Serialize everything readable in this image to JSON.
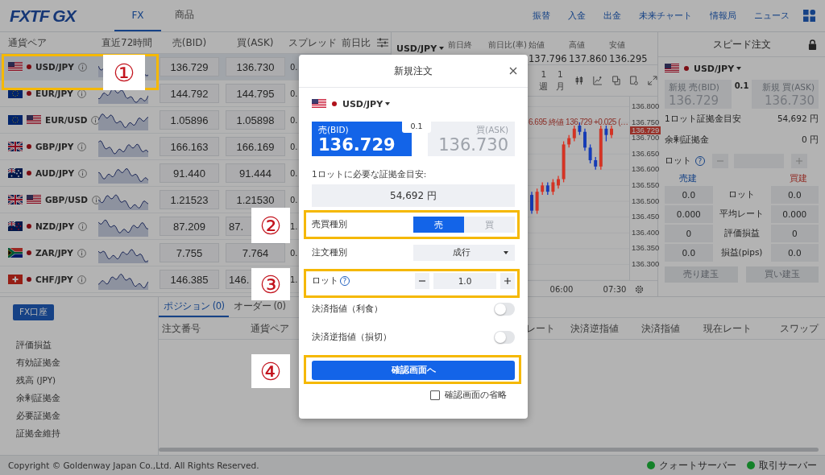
{
  "header": {
    "logo": "FXTF GX",
    "tabs": [
      {
        "label": "FX",
        "selected": true
      },
      {
        "label": "商品",
        "selected": false
      }
    ],
    "links": [
      "振替",
      "入金",
      "出金",
      "未来チャート",
      "情報局",
      "ニュース"
    ]
  },
  "rate_table": {
    "columns": [
      "通貨ペア",
      "直近72時間",
      "売(BID)",
      "買(ASK)",
      "スプレッド",
      "前日比"
    ],
    "rows": [
      {
        "pair": "USD/JPY",
        "bid": "136.729",
        "ask": "136.730",
        "spread": "0.",
        "selected": true,
        "ask_cut": false
      },
      {
        "pair": "EUR/JPY",
        "bid": "144.792",
        "ask": "144.795",
        "spread": "0.",
        "selected": false,
        "ask_cut": false
      },
      {
        "pair": "EUR/USD",
        "bid": "1.05896",
        "ask": "1.05898",
        "spread": "0.",
        "selected": false,
        "ask_cut": false
      },
      {
        "pair": "GBP/JPY",
        "bid": "166.163",
        "ask": "166.169",
        "spread": "0.",
        "selected": false,
        "ask_cut": false
      },
      {
        "pair": "AUD/JPY",
        "bid": "91.440",
        "ask": "91.444",
        "spread": "0.",
        "selected": false,
        "ask_cut": false
      },
      {
        "pair": "GBP/USD",
        "bid": "1.21523",
        "ask": "1.21530",
        "spread": "0.",
        "selected": false,
        "ask_cut": false
      },
      {
        "pair": "NZD/JPY",
        "bid": "87.209",
        "ask": "87.",
        "spread": "1.",
        "selected": false,
        "ask_cut": true
      },
      {
        "pair": "ZAR/JPY",
        "bid": "7.755",
        "ask": "7.764",
        "spread": "0.",
        "selected": false,
        "ask_cut": false
      },
      {
        "pair": "CHF/JPY",
        "bid": "146.385",
        "ask": "146.",
        "spread": "1.",
        "selected": false,
        "ask_cut": true
      }
    ]
  },
  "chart": {
    "pair": "USD/JPY",
    "stats": [
      {
        "label": "前日終"
      },
      {
        "label": "前日比(率)"
      },
      {
        "label": "始値",
        "value": "137.796"
      },
      {
        "label": "高値",
        "value": "137.860"
      },
      {
        "label": "安値",
        "value": "136.295"
      }
    ],
    "periods": [
      {
        "number": "1",
        "unit": "週"
      },
      {
        "number": "1",
        "unit": "月"
      }
    ],
    "legend": "6.695 終値 136.729 +0.025 (…",
    "last_price": "136.729",
    "chart_data": {
      "type": "candlestick",
      "categories": [
        null,
        null,
        null,
        null,
        null,
        null,
        "06:00",
        null,
        null,
        null,
        null,
        null,
        null,
        null,
        null,
        null,
        "07:30"
      ],
      "ylim": [
        136.249,
        136.831
      ],
      "ohlc": [
        [
          136.52,
          136.53,
          136.46,
          136.47
        ],
        [
          136.47,
          136.54,
          136.46,
          136.53
        ],
        [
          136.53,
          136.56,
          136.52,
          136.55
        ],
        [
          136.55,
          136.56,
          136.52,
          136.53
        ],
        [
          136.53,
          136.57,
          136.52,
          136.56
        ],
        [
          136.55,
          136.58,
          136.54,
          136.57
        ],
        [
          136.57,
          136.69,
          136.56,
          136.68
        ],
        [
          136.68,
          136.71,
          136.67,
          136.7
        ],
        [
          136.7,
          136.74,
          136.69,
          136.73
        ],
        [
          136.74,
          136.75,
          136.71,
          136.72
        ],
        [
          136.72,
          136.73,
          136.66,
          136.67
        ],
        [
          136.67,
          136.68,
          136.62,
          136.63
        ],
        [
          136.63,
          136.64,
          136.6,
          136.61
        ],
        [
          136.61,
          136.74,
          136.6,
          136.73
        ],
        [
          136.73,
          136.74,
          136.69,
          136.71
        ],
        [
          136.71,
          136.74,
          136.7,
          136.73
        ],
        null
      ],
      "yticks": [
        {
          "value": 136.8,
          "label": "136.800"
        },
        {
          "value": 136.75,
          "label": "136.750"
        },
        {
          "value": 136.7,
          "label": "136.700"
        },
        {
          "value": 136.65,
          "label": "136.650"
        },
        {
          "value": 136.6,
          "label": "136.600"
        },
        {
          "value": 136.55,
          "label": "136.550"
        },
        {
          "value": 136.5,
          "label": "136.500"
        },
        {
          "value": 136.45,
          "label": "136.450"
        },
        {
          "value": 136.4,
          "label": "136.400"
        },
        {
          "value": 136.35,
          "label": "136.350"
        },
        {
          "value": 136.3,
          "label": "136.300"
        }
      ]
    }
  },
  "speed_order": {
    "title": "スピード注文",
    "pair": "USD/JPY",
    "bid": {
      "label": "新規 売(BID)",
      "price": "136.729"
    },
    "spread": "0.1",
    "ask": {
      "label": "新規 買(ASK)",
      "price": "136.730"
    },
    "info": [
      {
        "label": "1ロット証拠金目安",
        "value": "54,692 円"
      },
      {
        "label": "余剰証拠金",
        "value": "0 円"
      }
    ],
    "lot_label": "ロット",
    "help_mark": "?",
    "sell_heading": "売建",
    "buy_heading": "買建",
    "summary": [
      {
        "sell": "0.0",
        "label": "ロット",
        "buy": "0.0"
      },
      {
        "sell": "0.000",
        "label": "平均レート",
        "buy": "0.000"
      },
      {
        "sell": "0",
        "label": "評価損益",
        "buy": "0"
      },
      {
        "sell": "0.0",
        "label": "損益(pips)",
        "buy": "0.0"
      }
    ],
    "buttons": [
      {
        "label": "売り建玉",
        "disabled": true
      },
      {
        "label": "買い建玉",
        "disabled": true
      }
    ]
  },
  "account": {
    "button": "FX口座",
    "items": [
      "評価損益",
      "有効証拠金",
      "残高 (JPY)",
      "余剰証拠金",
      "必要証拠金",
      "証拠金維持"
    ]
  },
  "positions": {
    "tabs": [
      {
        "label": "ポジション (0)",
        "selected": true
      },
      {
        "label": "オーダー (0)",
        "selected": false
      }
    ],
    "columns": [
      "注文番号",
      "通貨ペア",
      "レート",
      "決済逆指値",
      "決済指値",
      "現在レート",
      "スワップ"
    ]
  },
  "footer": {
    "copyright": "Copyright © Goldenway Japan Co.,Ltd. All Rights Reserved.",
    "servers": [
      {
        "label": "クォートサーバー",
        "online": true
      },
      {
        "label": "取引サーバー",
        "online": true
      }
    ]
  },
  "order_dialog": {
    "title": "新規注文",
    "pair": "USD/JPY",
    "bid": {
      "label": "売(BID)",
      "price": "136.729",
      "selected": true
    },
    "spread": "0.1",
    "ask": {
      "label": "買(ASK)",
      "price": "136.730",
      "selected": false
    },
    "margin_label": "1ロットに必要な証拠金目安:",
    "margin_value": "54,692 円",
    "help_mark": "?",
    "fields": [
      {
        "kind": "segmented",
        "label": "売買種別",
        "options": [
          {
            "label": "売",
            "selected": true
          },
          {
            "label": "買",
            "selected": false
          }
        ]
      },
      {
        "kind": "dropdown",
        "label": "注文種別",
        "value": "成行"
      },
      {
        "kind": "stepper",
        "label": "ロット",
        "value": "1.0"
      },
      {
        "kind": "toggle",
        "label": "決済指値（利食）",
        "on": false
      },
      {
        "kind": "toggle",
        "label": "決済逆指値（損切）",
        "on": false
      }
    ],
    "confirm_button": "確認画面へ",
    "skip_confirm": {
      "label": "確認画面の省略",
      "checked": false
    }
  },
  "annotations": [
    {
      "label": "①"
    },
    {
      "label": "②"
    },
    {
      "label": "③"
    },
    {
      "label": "④"
    }
  ]
}
